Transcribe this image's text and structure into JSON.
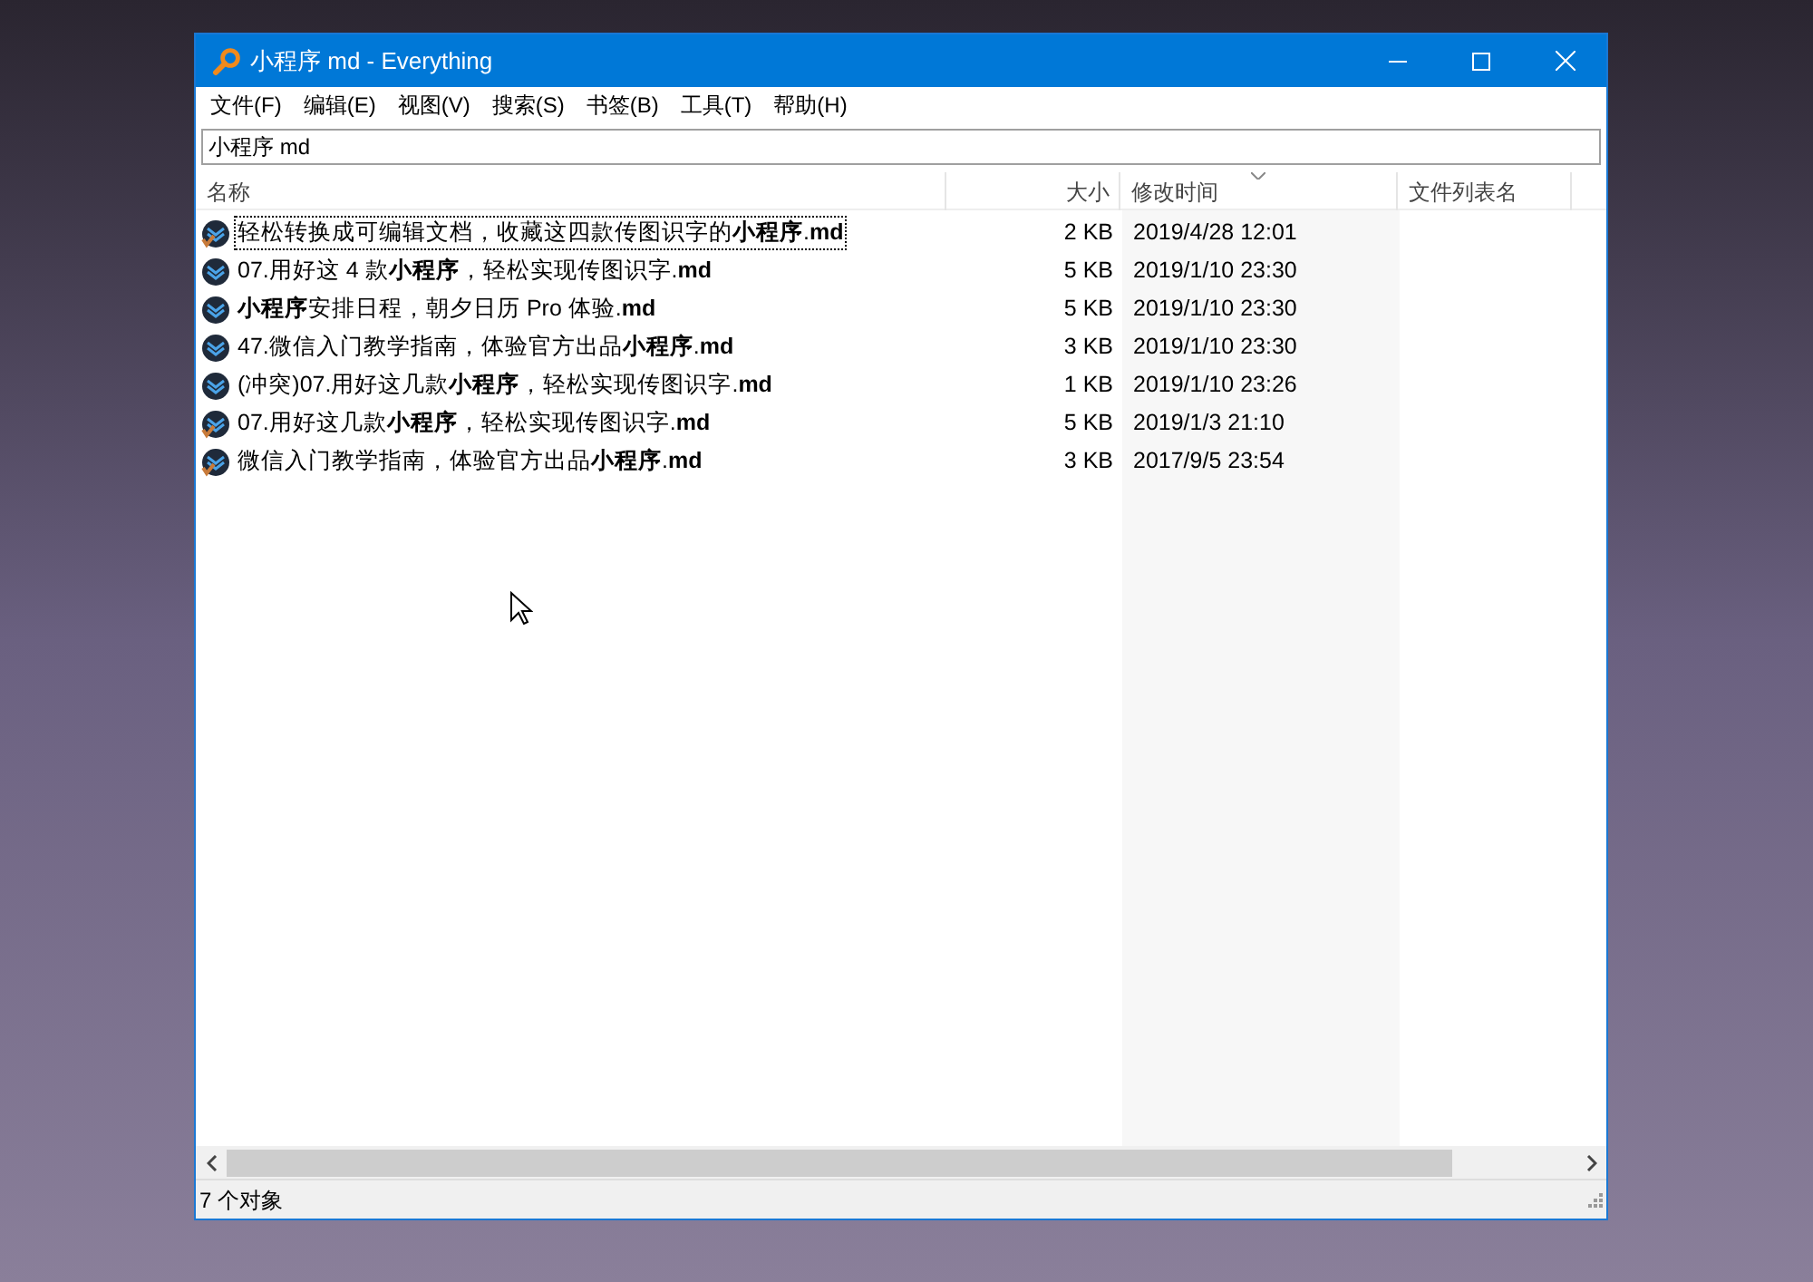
{
  "window": {
    "title": "小程序 md - Everything"
  },
  "menu": [
    "文件(F)",
    "编辑(E)",
    "视图(V)",
    "搜索(S)",
    "书签(B)",
    "工具(T)",
    "帮助(H)"
  ],
  "search": {
    "value": "小程序 md"
  },
  "columns": [
    {
      "label": "名称",
      "sorted": false
    },
    {
      "label": "大小",
      "sorted": false
    },
    {
      "label": "修改时间",
      "sorted": true
    },
    {
      "label": "文件列表名",
      "sorted": false
    }
  ],
  "rows": [
    {
      "name": "轻松转换成可编辑文档，收藏这四款传图识字的**小程序**.**md**",
      "size": "2 KB",
      "modified": "2019/4/28 12:01",
      "focused": true,
      "overlay": true
    },
    {
      "name": "07.用好这 4 款**小程序**，轻松实现传图识字.**md**",
      "size": "5 KB",
      "modified": "2019/1/10 23:30",
      "focused": false,
      "overlay": false
    },
    {
      "name": "**小程序**安排日程，朝夕日历 Pro 体验.**md**",
      "size": "5 KB",
      "modified": "2019/1/10 23:30",
      "focused": false,
      "overlay": false
    },
    {
      "name": "47.微信入门教学指南，体验官方出品**小程序**.**md**",
      "size": "3 KB",
      "modified": "2019/1/10 23:30",
      "focused": false,
      "overlay": false
    },
    {
      "name": "(冲突)07.用好这几款**小程序**，轻松实现传图识字.**md**",
      "size": "1 KB",
      "modified": "2019/1/10 23:26",
      "focused": false,
      "overlay": false
    },
    {
      "name": "07.用好这几款**小程序**，轻松实现传图识字.**md**",
      "size": "5 KB",
      "modified": "2019/1/3 21:10",
      "focused": false,
      "overlay": true
    },
    {
      "name": "微信入门教学指南，体验官方出品**小程序**.**md**",
      "size": "3 KB",
      "modified": "2017/9/5 23:54",
      "focused": false,
      "overlay": true
    }
  ],
  "status_bar": "7 个对象"
}
